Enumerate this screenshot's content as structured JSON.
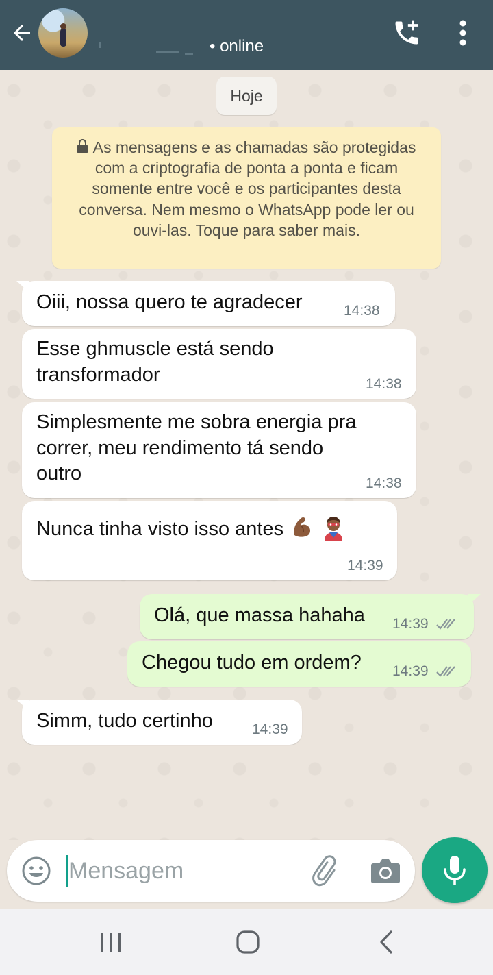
{
  "header": {
    "back_icon": "arrow-left-icon",
    "avatar_icon": "contact-avatar",
    "status": "• online",
    "call_icon": "add-call-icon",
    "menu_icon": "more-vertical-icon"
  },
  "date_chip": "Hoje",
  "encryption_notice": {
    "icon": "lock-icon",
    "text": "As mensagens e as chamadas são protegidas com a criptografia de ponta a ponta e ficam somente entre você e os participantes desta conversa. Nem mesmo o WhatsApp pode ler ou ouvi-las. Toque para saber mais."
  },
  "messages": [
    {
      "direction": "incoming",
      "lines": [
        "Oiii, nossa quero te agradecer"
      ],
      "time": "14:38"
    },
    {
      "direction": "incoming",
      "lines": [
        "Esse ghmuscle está sendo",
        "transformador"
      ],
      "time": "14:38"
    },
    {
      "direction": "incoming",
      "lines": [
        "Simplesmente me sobra energia pra",
        "correr, meu rendimento tá sendo",
        "outro"
      ],
      "time": "14:38"
    },
    {
      "direction": "incoming",
      "lines": [
        "Nunca tinha visto isso antes"
      ],
      "emojis": [
        "flexed-biceps-emoji",
        "superhero-emoji"
      ],
      "time": "14:39"
    },
    {
      "direction": "outgoing",
      "lines": [
        "Olá, que massa hahaha"
      ],
      "time": "14:39",
      "status": "read"
    },
    {
      "direction": "outgoing",
      "lines": [
        "Chegou tudo em ordem?"
      ],
      "time": "14:39",
      "status": "read"
    },
    {
      "direction": "incoming",
      "lines": [
        "Simm, tudo certinho"
      ],
      "time": "14:39"
    }
  ],
  "composer": {
    "placeholder": "Mensagem",
    "emoji_icon": "emoji-icon",
    "attach_icon": "paperclip-icon",
    "camera_icon": "camera-icon",
    "mic_icon": "microphone-icon"
  },
  "navbar": {
    "recents_icon": "recents-icon",
    "home_icon": "home-icon",
    "back_icon": "back-chevron-icon"
  },
  "colors": {
    "header": "#3d5560",
    "chat_background": "#ece5dd",
    "incoming_bubble": "#ffffff",
    "outgoing_bubble": "#e4fbd2",
    "notice_background": "#fcefc2",
    "accent": "#1aa883",
    "read_ticks": "#8a969b"
  }
}
